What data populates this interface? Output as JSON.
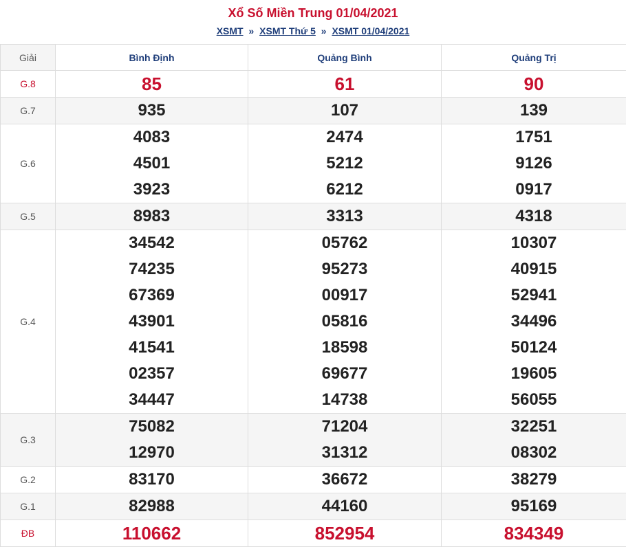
{
  "header": {
    "title": "Xổ Số Miền Trung 01/04/2021",
    "crumbs": [
      "XSMT",
      "XSMT Thứ 5",
      "XSMT 01/04/2021"
    ],
    "separator": "»"
  },
  "table": {
    "label_header": "Giải",
    "provinces": [
      "Bình Định",
      "Quảng Bình",
      "Quảng Trị"
    ],
    "rows": [
      {
        "name": "G.8",
        "red": true,
        "values": [
          [
            "85"
          ],
          [
            "61"
          ],
          [
            "90"
          ]
        ]
      },
      {
        "name": "G.7",
        "values": [
          [
            "935"
          ],
          [
            "107"
          ],
          [
            "139"
          ]
        ]
      },
      {
        "name": "G.6",
        "values": [
          [
            "4083",
            "4501",
            "3923"
          ],
          [
            "2474",
            "5212",
            "6212"
          ],
          [
            "1751",
            "9126",
            "0917"
          ]
        ]
      },
      {
        "name": "G.5",
        "values": [
          [
            "8983"
          ],
          [
            "3313"
          ],
          [
            "4318"
          ]
        ]
      },
      {
        "name": "G.4",
        "values": [
          [
            "34542",
            "74235",
            "67369",
            "43901",
            "41541",
            "02357",
            "34447"
          ],
          [
            "05762",
            "95273",
            "00917",
            "05816",
            "18598",
            "69677",
            "14738"
          ],
          [
            "10307",
            "40915",
            "52941",
            "34496",
            "50124",
            "19605",
            "56055"
          ]
        ]
      },
      {
        "name": "G.3",
        "values": [
          [
            "75082",
            "12970"
          ],
          [
            "71204",
            "31312"
          ],
          [
            "32251",
            "08302"
          ]
        ]
      },
      {
        "name": "G.2",
        "values": [
          [
            "83170"
          ],
          [
            "36672"
          ],
          [
            "38279"
          ]
        ]
      },
      {
        "name": "G.1",
        "values": [
          [
            "82988"
          ],
          [
            "44160"
          ],
          [
            "95169"
          ]
        ]
      },
      {
        "name": "ĐB",
        "red": true,
        "values": [
          [
            "110662"
          ],
          [
            "852954"
          ],
          [
            "834349"
          ]
        ]
      }
    ]
  },
  "colors": {
    "accent_red": "#c8102e",
    "link_blue": "#1f3e7a"
  }
}
